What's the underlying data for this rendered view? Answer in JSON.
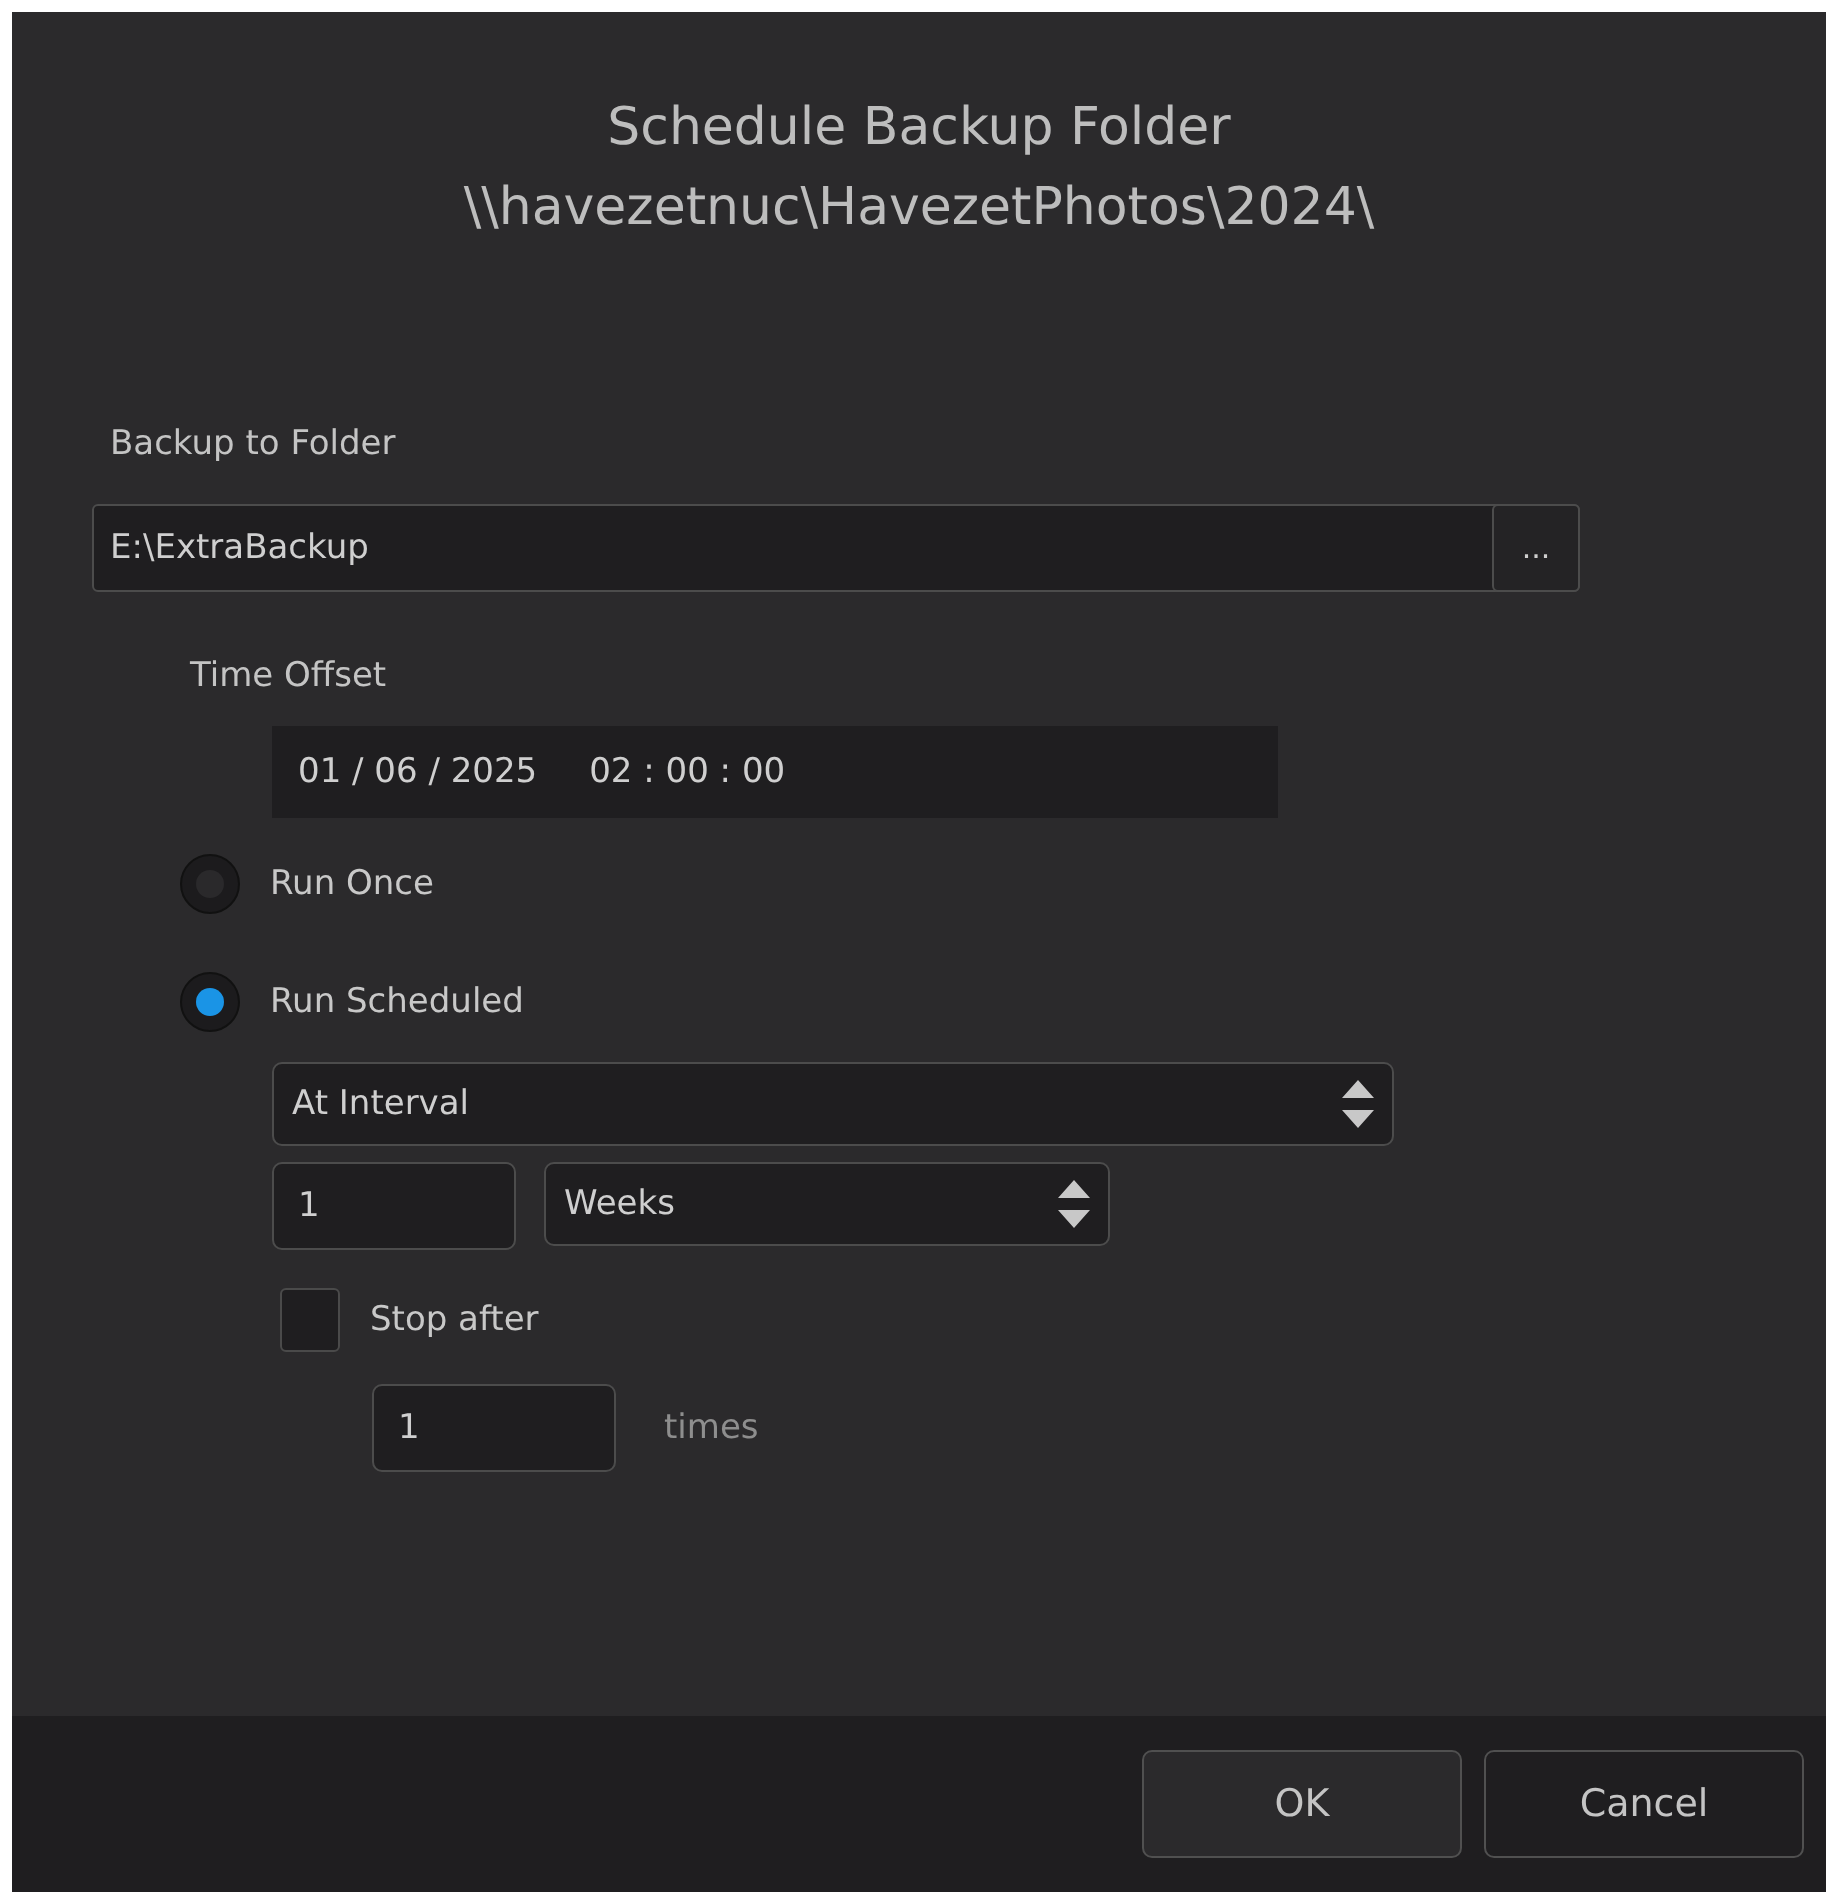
{
  "dialog": {
    "title": "Schedule Backup Folder",
    "subtitle": "\\\\havezetnuc\\HavezetPhotos\\2024\\"
  },
  "destination": {
    "label": "Backup to Folder",
    "value": "E:\\ExtraBackup",
    "browse_button": "..."
  },
  "time_offset": {
    "label": "Time Offset",
    "date": "01 / 06 / 2025",
    "time": "02 : 00 : 00"
  },
  "run_options": [
    {
      "label": "Run Once",
      "selected": false
    },
    {
      "label": "Run Scheduled",
      "selected": true
    }
  ],
  "schedule": {
    "mode": "At Interval",
    "interval_value": "1",
    "interval_unit": "Weeks"
  },
  "stop_after": {
    "label": "Stop after",
    "checked": false,
    "count": "1",
    "unit": "times"
  },
  "buttons": [
    {
      "label": "OK",
      "hovered": true
    },
    {
      "label": "Cancel",
      "hovered": false
    }
  ]
}
